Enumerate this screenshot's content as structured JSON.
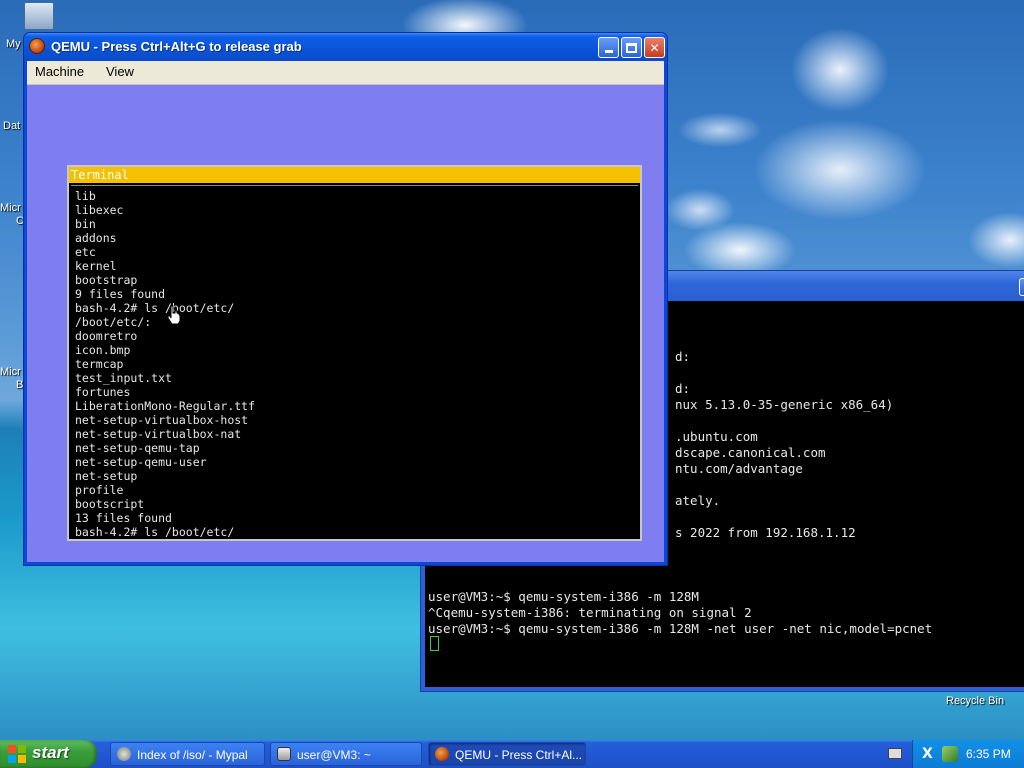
{
  "desktop": {
    "icons": [
      {
        "label": "My"
      },
      {
        "label": "Dat"
      },
      {
        "label": "Micr"
      },
      {
        "label": "Micr"
      }
    ],
    "icons_extra": [
      "C",
      "B"
    ],
    "recycle_bin_label": "Recycle Bin"
  },
  "host_terminal": {
    "lines": [
      "d:",
      "d:",
      "nux 5.13.0-35-generic x86_64)",
      "",
      ".ubuntu.com",
      "dscape.canonical.com",
      "ntu.com/advantage",
      "",
      "ately.",
      "",
      "s 2022 from 192.168.1.12",
      "",
      "",
      "",
      "user@VM3:~$ qemu-system-i386 -m 128M",
      "^Cqemu-system-i386: terminating on signal 2",
      "user@VM3:~$ qemu-system-i386 -m 128M -net user -net nic,model=pcnet"
    ]
  },
  "qemu": {
    "title": "QEMU - Press Ctrl+Alt+G to release grab",
    "menu": {
      "machine": "Machine",
      "view": "View"
    },
    "guest_terminal": {
      "title": "Terminal",
      "lines": [
        "lib",
        "libexec",
        "bin",
        "addons",
        "etc",
        "kernel",
        "bootstrap",
        "9 files found",
        "bash-4.2# ls /boot/etc/",
        "/boot/etc/:",
        "doomretro",
        "icon.bmp",
        "termcap",
        "test_input.txt",
        "fortunes",
        "LiberationMono-Regular.ttf",
        "net-setup-virtualbox-host",
        "net-setup-virtualbox-nat",
        "net-setup-qemu-tap",
        "net-setup-qemu-user",
        "net-setup",
        "profile",
        "bootscript",
        "13 files found",
        "bash-4.2# ls /boot/etc/_"
      ]
    }
  },
  "taskbar": {
    "start_label": "start",
    "tasks": [
      {
        "label": "Index of /iso/ - Mypal",
        "icon": "browser-icon"
      },
      {
        "label": "user@VM3: ~",
        "icon": "terminal-icon"
      },
      {
        "label": "QEMU - Press Ctrl+Al...",
        "icon": "qemu-icon",
        "active": true
      }
    ],
    "clock": "6:35 PM"
  },
  "colors": {
    "qemu_screen_bg": "#7f7ef0",
    "guest_title_bg": "#f5c000",
    "xp_blue": "#0a49d8",
    "start_green": "#3a9e3a"
  }
}
